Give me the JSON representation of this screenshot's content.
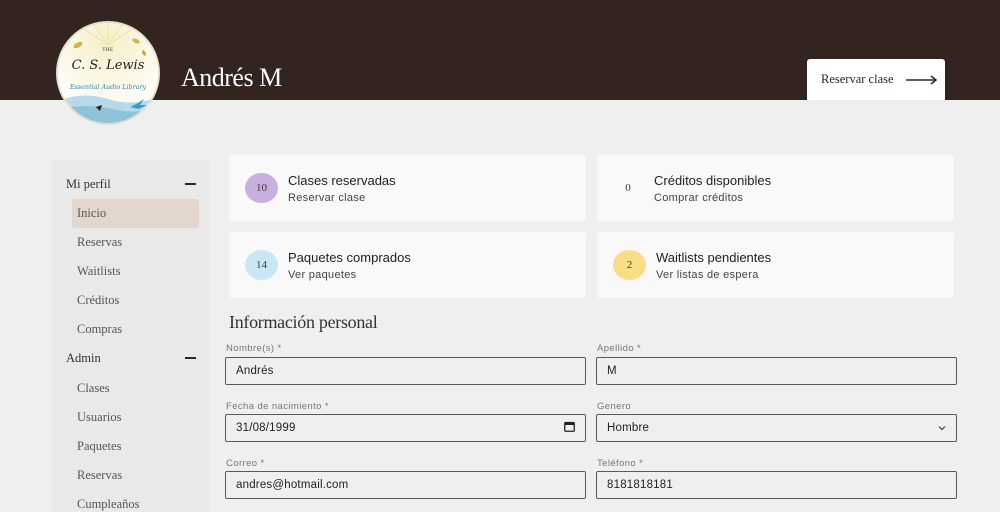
{
  "header": {
    "user_name": "Andrés M",
    "reserve_button": "Reservar clase",
    "logo": {
      "the": "THE",
      "name": "C. S. Lewis",
      "subtitle": "Essential Audio Library"
    }
  },
  "sidebar": {
    "sections": [
      {
        "label": "Mi perfil",
        "items": [
          "Inicio",
          "Reservas",
          "Waitlists",
          "Créditos",
          "Compras"
        ]
      },
      {
        "label": "Admin",
        "items": [
          "Clases",
          "Usuarios",
          "Paquetes",
          "Reservas",
          "Cumpleaños"
        ]
      }
    ],
    "active_item": "Inicio"
  },
  "cards": [
    {
      "badge": "10",
      "title": "Clases reservadas",
      "subtitle": "Reservar clase",
      "color": "#c9aee0"
    },
    {
      "badge": "0",
      "title": "Créditos disponibles",
      "subtitle": "Comprar créditos",
      "color": ""
    },
    {
      "badge": "14",
      "title": "Paquetes comprados",
      "subtitle": "Ver paquetes",
      "color": "#cbe6f7"
    },
    {
      "badge": "2",
      "title": "Waitlists pendientes",
      "subtitle": "Ver listas de espera",
      "color": "#f9dd86"
    }
  ],
  "form": {
    "title": "Información personal",
    "nombre": {
      "label": "Nombre(s) *",
      "value": "Andrés"
    },
    "apellido": {
      "label": "Apellido *",
      "value": "M"
    },
    "fecha": {
      "label": "Fecha de nacimiento *",
      "value": "31/08/1999"
    },
    "genero": {
      "label": "Genero",
      "value": "Hombre"
    },
    "correo": {
      "label": "Correo *",
      "value": "andres@hotmail.com"
    },
    "telefono": {
      "label": "Teléfono *",
      "value": "8181818181"
    }
  },
  "colors": {
    "header_bg": "#33241f",
    "active_item_bg": "#e3d6cc",
    "page_bg": "#efefef"
  }
}
